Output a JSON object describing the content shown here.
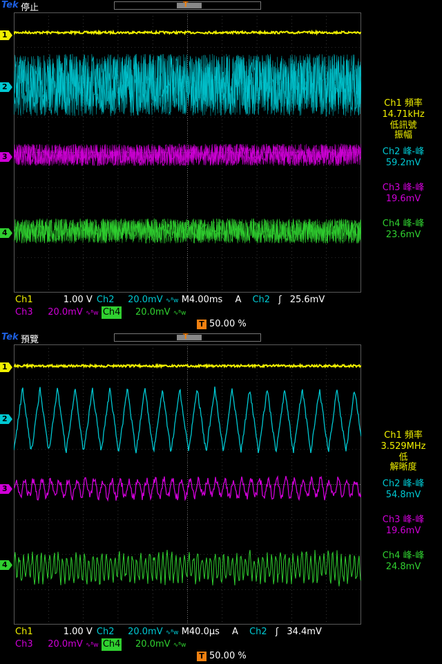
{
  "colors": {
    "ch1": "#f0f000",
    "ch2": "#00c8d2",
    "ch3": "#d000d8",
    "ch4": "#30d030",
    "grid": "#5a5a5a",
    "trigger": "#f08010",
    "brand": "#1d5fe0"
  },
  "panels": [
    {
      "brand": "Tek",
      "status": "停止",
      "marker_1": "1",
      "marker_2": "2",
      "marker_3": "3",
      "marker_4": "4",
      "trigger_marker": "T",
      "readouts": {
        "ch1_label": "Ch1 頻率",
        "ch1_value": "14.71kHz",
        "ch1_note1": "低訊號",
        "ch1_note2": "振幅",
        "ch2_label": "Ch2 峰-峰",
        "ch2_value": "59.2mV",
        "ch3_label": "Ch3 峰-峰",
        "ch3_value": "19.6mV",
        "ch4_label": "Ch4 峰-峰",
        "ch4_value": "23.6mV"
      },
      "settings": {
        "ch1_name": "Ch1",
        "ch1_scale": "1.00 V",
        "ch2_name": "Ch2",
        "ch2_scale": "20.0mV",
        "ch3_name": "Ch3",
        "ch3_scale": "20.0mV",
        "ch4_name": "Ch4",
        "ch4_scale": "20.0mV",
        "bw_symbol": "∿ᴮw",
        "timebase": "M4.00ms",
        "trigger_mode": "A",
        "trigger_source": "Ch2",
        "trigger_slope": "ʃ",
        "trigger_level": "25.6mV",
        "trigger_position": "50.00 %"
      }
    },
    {
      "brand": "Tek",
      "status": "預覽",
      "marker_1": "1",
      "marker_2": "2",
      "marker_3": "3",
      "marker_4": "4",
      "trigger_marker": "T",
      "readouts": {
        "ch1_label": "Ch1 頻率",
        "ch1_value": "3.529MHz",
        "ch1_note1": "低",
        "ch1_note2": "解晰度",
        "ch2_label": "Ch2 峰-峰",
        "ch2_value": "54.8mV",
        "ch3_label": "Ch3 峰-峰",
        "ch3_value": "19.6mV",
        "ch4_label": "Ch4 峰-峰",
        "ch4_value": "24.8mV"
      },
      "settings": {
        "ch1_name": "Ch1",
        "ch1_scale": "1.00 V",
        "ch2_name": "Ch2",
        "ch2_scale": "20.0mV",
        "ch3_name": "Ch3",
        "ch3_scale": "20.0mV",
        "ch4_name": "Ch4",
        "ch4_scale": "20.0mV",
        "bw_symbol": "∿ᴮw",
        "timebase": "M40.0µs",
        "trigger_mode": "A",
        "trigger_source": "Ch2",
        "trigger_slope": "ʃ",
        "trigger_level": "34.4mV",
        "trigger_position": "50.00 %"
      }
    }
  ]
}
